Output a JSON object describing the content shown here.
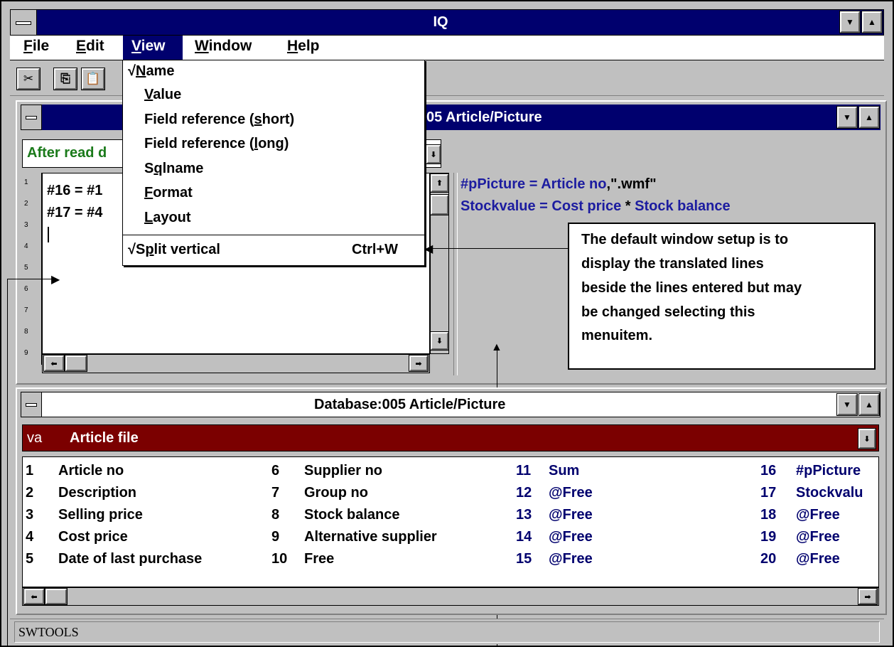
{
  "app": {
    "title": "IQ",
    "status_text": "SWTOOLS"
  },
  "menubar": {
    "items": [
      {
        "label": "File",
        "mnemonic": "F",
        "rest": "ile"
      },
      {
        "label": "Edit",
        "mnemonic": "E",
        "rest": "dit"
      },
      {
        "label": "View",
        "mnemonic": "V",
        "rest": "iew"
      },
      {
        "label": "Window",
        "mnemonic": "W",
        "rest": "indow"
      },
      {
        "label": "Help",
        "mnemonic": "H",
        "rest": "elp"
      }
    ]
  },
  "toolbar": {
    "icons": [
      "cut-icon",
      "copy-icon",
      "paste-icon"
    ]
  },
  "view_menu": {
    "items": [
      {
        "check": "√",
        "pre": "",
        "mn": "N",
        "post": "ame",
        "shortcut": ""
      },
      {
        "check": "",
        "pre": "",
        "mn": "V",
        "post": "alue",
        "shortcut": ""
      },
      {
        "check": "",
        "pre": "Field reference (",
        "mn": "s",
        "post": "hort)",
        "shortcut": ""
      },
      {
        "check": "",
        "pre": "Field reference (",
        "mn": "l",
        "post": "ong)",
        "shortcut": ""
      },
      {
        "check": "",
        "pre": "S",
        "mn": "q",
        "post": "lname",
        "shortcut": ""
      },
      {
        "check": "",
        "pre": "",
        "mn": "F",
        "post": "ormat",
        "shortcut": ""
      },
      {
        "check": "",
        "pre": "",
        "mn": "L",
        "post": "ayout",
        "shortcut": ""
      },
      {
        "check": "√",
        "pre": "S",
        "mn": "p",
        "post": "lit vertical",
        "shortcut": "Ctrl+W"
      }
    ]
  },
  "editor_window": {
    "title_visible": "05  Article/Picture",
    "event_dropdown_value": "After read d",
    "lines": [
      "#16 = #1",
      "#17 = #4",
      ""
    ],
    "line_numbers": [
      "1",
      "2",
      "3",
      "4",
      "5",
      "6",
      "7",
      "8",
      "9"
    ],
    "translated_lines": [
      {
        "parts": [
          "#pPicture",
          " = ",
          "Article no",
          ",\".wmf\""
        ]
      },
      {
        "parts": [
          "Stockvalue",
          " = ",
          "Cost price",
          " * ",
          "Stock balance"
        ]
      }
    ]
  },
  "callout": {
    "text_lines": [
      "The default window setup is to",
      "display the translated lines",
      "beside the lines entered but may",
      "be changed selecting this",
      "menuitem."
    ]
  },
  "database_window": {
    "title": "Database:005  Article/Picture",
    "file_select": {
      "code": "va",
      "name": "Article file"
    },
    "fields_col1": [
      {
        "no": "1",
        "name": "Article no"
      },
      {
        "no": "2",
        "name": "Description"
      },
      {
        "no": "3",
        "name": "Selling price"
      },
      {
        "no": "4",
        "name": "Cost price"
      },
      {
        "no": "5",
        "name": "Date of last purchase"
      }
    ],
    "fields_col2": [
      {
        "no": "6",
        "name": "Supplier no"
      },
      {
        "no": "7",
        "name": "Group no"
      },
      {
        "no": "8",
        "name": "Stock balance"
      },
      {
        "no": "9",
        "name": "Alternative supplier"
      },
      {
        "no": "10",
        "name": "Free"
      }
    ],
    "fields_col3": [
      {
        "no": "11",
        "name": "Sum"
      },
      {
        "no": "12",
        "name": "@Free"
      },
      {
        "no": "13",
        "name": "@Free"
      },
      {
        "no": "14",
        "name": "@Free"
      },
      {
        "no": "15",
        "name": "@Free"
      }
    ],
    "fields_col4": [
      {
        "no": "16",
        "name": "#pPicture"
      },
      {
        "no": "17",
        "name": "Stockvalu"
      },
      {
        "no": "18",
        "name": "@Free"
      },
      {
        "no": "19",
        "name": "@Free"
      },
      {
        "no": "20",
        "name": "@Free"
      }
    ]
  },
  "colors": {
    "titlebar": "#00006e",
    "menu_highlight": "#00006e",
    "file_bar": "#7b0000",
    "workspace": "#c0c0c0",
    "field_blue": "#1c1ca0"
  }
}
